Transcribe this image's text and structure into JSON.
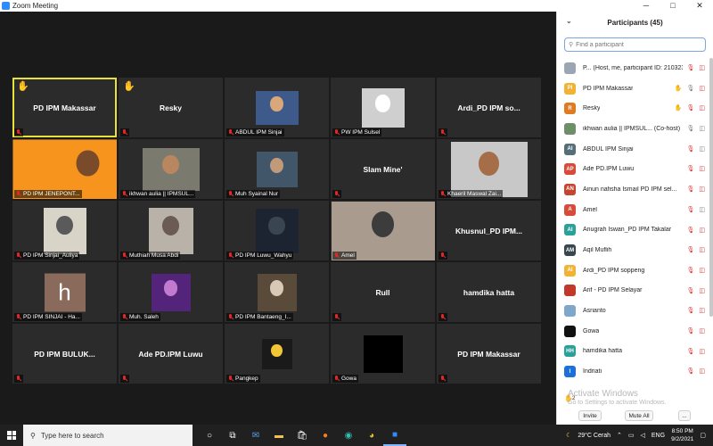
{
  "window": {
    "title": "Zoom Meeting",
    "min": "─",
    "max": "□",
    "close": "✕"
  },
  "tiles": [
    {
      "name": "PD IPM Makassar",
      "big": true,
      "hand": true,
      "active": true
    },
    {
      "name": "Resky",
      "big": true,
      "hand": true
    },
    {
      "name": "ABDUL IPM Sinjai",
      "photo": "person"
    },
    {
      "name": "PW IPM Sulsel",
      "photo": "clock"
    },
    {
      "name": "Ardi_PD IPM so...",
      "big": true
    },
    {
      "name": "PD IPM JENEPONT...",
      "photo": "orange"
    },
    {
      "name": "ikhwan aulia || IPMSUL...",
      "photo": "person2"
    },
    {
      "name": "Muh Syainal Nur",
      "photo": "person3"
    },
    {
      "name": "Slam Mine'",
      "big": true
    },
    {
      "name": "Khaeril Maswal Zai...",
      "photo": "person4"
    },
    {
      "name": "PD IPM Sinjai_Auliya",
      "photo": "hijab"
    },
    {
      "name": "Muthiah Musa Abdi",
      "photo": "hijab2"
    },
    {
      "name": "PD IPM Luwu_Wahyu",
      "photo": "dark"
    },
    {
      "name": "Amel",
      "photo": "hijab3"
    },
    {
      "name": "Khusnul_PD IPM...",
      "big": true
    },
    {
      "name": "PD IPM SINJAI - Ha...",
      "photo": "hlogo",
      "letter": "h"
    },
    {
      "name": "Muh. Saleh",
      "photo": "purple"
    },
    {
      "name": "PD IPM Bantaeng_I...",
      "photo": "group"
    },
    {
      "name": "Rull",
      "big": true
    },
    {
      "name": "hamdika hatta",
      "big": true
    },
    {
      "name": "PD IPM BULUK...",
      "big": true
    },
    {
      "name": "Ade PD.IPM Luwu",
      "big": true
    },
    {
      "name": "Pangkep",
      "photo": "logo"
    },
    {
      "name": "Gowa",
      "photo": "black"
    },
    {
      "name": "PD IPM Makassar",
      "big": true
    }
  ],
  "panel": {
    "title": "Participants (45)",
    "search_placeholder": "Find a participant",
    "participants": [
      {
        "initials": "",
        "name": "P...   (Host, me, participant ID: 210323)",
        "color": "#9aa7b3",
        "icons": [
          "mic-off",
          "cam-off"
        ]
      },
      {
        "initials": "PI",
        "name": "PD IPM Makassar",
        "color": "#f2b233",
        "icons": [
          "hand",
          "mic",
          "cam-off"
        ]
      },
      {
        "initials": "R",
        "name": "Resky",
        "color": "#e07b24",
        "icons": [
          "hand",
          "mic-off",
          "cam-off"
        ]
      },
      {
        "initials": "",
        "name": "ikhwan aulia || IPMSUL... (Co-host)",
        "color": "#6e8f6a",
        "icons": [
          "mic",
          "cam"
        ]
      },
      {
        "initials": "AI",
        "name": "ABDUL IPM Sinjai",
        "color": "#546e7a",
        "icons": [
          "mic-off",
          "cam"
        ]
      },
      {
        "initials": "AP",
        "name": "Ade PD.IPM Luwu",
        "color": "#d84a3a",
        "icons": [
          "mic-off",
          "cam-off"
        ]
      },
      {
        "initials": "AN",
        "name": "Ainun nafisha Ismail PD IPM sel...",
        "color": "#c6452f",
        "icons": [
          "mic-off",
          "cam-off"
        ]
      },
      {
        "initials": "A",
        "name": "Amel",
        "color": "#d84a3a",
        "icons": [
          "mic-off",
          "cam"
        ]
      },
      {
        "initials": "AI",
        "name": "Anugrah Iswan_PD IPM Takalar",
        "color": "#2aa198",
        "icons": [
          "mic-off",
          "cam-off"
        ]
      },
      {
        "initials": "AM",
        "name": "Aqil Muflih",
        "color": "#37474f",
        "icons": [
          "mic-off",
          "cam-off"
        ]
      },
      {
        "initials": "AI",
        "name": "Ardi_PD IPM soppeng",
        "color": "#f2b233",
        "icons": [
          "mic-off",
          "cam-off"
        ]
      },
      {
        "initials": "",
        "name": "Arif - PD IPM Selayar",
        "color": "#c0392b",
        "icons": [
          "mic-off",
          "cam-off"
        ]
      },
      {
        "initials": "",
        "name": "Asrianto",
        "color": "#7fa7c9",
        "icons": [
          "mic-off",
          "cam-off"
        ]
      },
      {
        "initials": "",
        "name": "Gowa",
        "color": "#111111",
        "icons": [
          "mic-off",
          "cam-off"
        ]
      },
      {
        "initials": "HH",
        "name": "hamdika hatta",
        "color": "#2aa198",
        "icons": [
          "mic-off",
          "cam-off"
        ]
      },
      {
        "initials": "I",
        "name": "Indriati",
        "color": "#1e6fd9",
        "icons": [
          "mic-off",
          "cam-off"
        ]
      }
    ],
    "activate_title": "Activate Windows",
    "activate_sub": "Go to Settings to activate Windows.",
    "invite": "Invite",
    "mute_all": "Mute All",
    "more": "...",
    "reaction_count": "2"
  },
  "taskbar": {
    "search_placeholder": "Type here to search",
    "weather": "29°C  Cerah",
    "lang": "ENG",
    "time": "8:50 PM",
    "date": "9/2/2021"
  }
}
